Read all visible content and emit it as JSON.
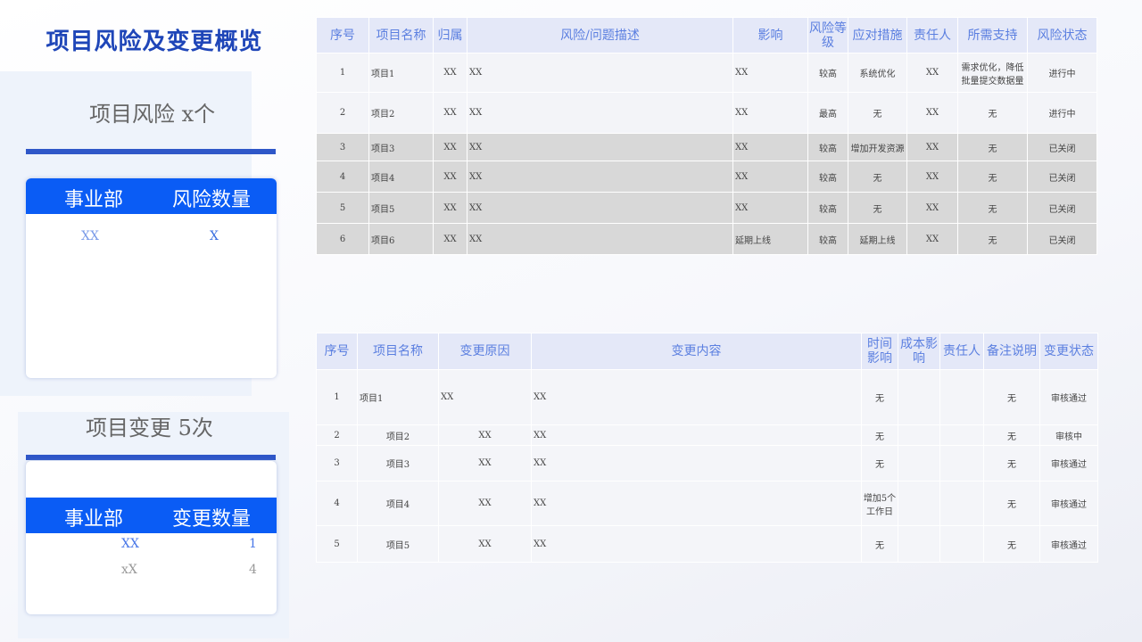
{
  "page_title": "项目风险及变更概览",
  "risk_summary": {
    "count_label": "项目风险 x个",
    "header": [
      "事业部",
      "风险数量"
    ],
    "rows": [
      {
        "dept": "XX",
        "count": "X"
      }
    ]
  },
  "change_summary": {
    "count_label": "项目变更  5次",
    "header": [
      "事业部",
      "变更数量"
    ],
    "rows": [
      {
        "dept": "XX",
        "count": "1"
      },
      {
        "dept": "xX",
        "count": "4"
      }
    ]
  },
  "risk_table": {
    "headers": [
      "序号",
      "项目名称",
      "归属",
      "风险/问题描述",
      "影响",
      "风险等级",
      "应对措施",
      "责任人",
      "所需支持",
      "风险状态"
    ],
    "rows": [
      [
        "1",
        "项目1",
        "XX",
        "XX",
        "XX",
        "较高",
        "系统优化",
        "XX",
        "需求优化，降低批量提交数据量",
        "进行中"
      ],
      [
        "2",
        "项目2",
        "XX",
        "XX",
        "XX",
        "最高",
        "无",
        "XX",
        "无",
        "进行中"
      ],
      [
        "3",
        "项目3",
        "XX",
        "XX",
        "XX",
        "较高",
        "增加开发资源",
        "XX",
        "无",
        "已关闭"
      ],
      [
        "4",
        "项目4",
        "XX",
        "XX",
        "XX",
        "较高",
        "无",
        "XX",
        "无",
        "已关闭"
      ],
      [
        "5",
        "项目5",
        "XX",
        "XX",
        "XX",
        "较高",
        "无",
        "XX",
        "无",
        "已关闭"
      ],
      [
        "6",
        "项目6",
        "XX",
        "XX",
        "延期上线",
        "较高",
        "延期上线",
        "XX",
        "无",
        "已关闭"
      ]
    ]
  },
  "change_table": {
    "headers": [
      "序号",
      "项目名称",
      "变更原因",
      "变更内容",
      "时间影响",
      "成本影响",
      "责任人",
      "备注说明",
      "变更状态"
    ],
    "rows": [
      [
        "1",
        "项目1",
        "XX",
        "XX",
        "无",
        "",
        "",
        "无",
        "审核通过"
      ],
      [
        "2",
        "项目2",
        "XX",
        "XX",
        "无",
        "",
        "",
        "无",
        "审核中"
      ],
      [
        "3",
        "项目3",
        "XX",
        "XX",
        "无",
        "",
        "",
        "无",
        "审核通过"
      ],
      [
        "4",
        "项目4",
        "XX",
        "XX",
        "增加5个工作日",
        "",
        "",
        "无",
        "审核通过"
      ],
      [
        "5",
        "项目5",
        "XX",
        "XX",
        "无",
        "",
        "",
        "无",
        "审核通过"
      ]
    ]
  }
}
